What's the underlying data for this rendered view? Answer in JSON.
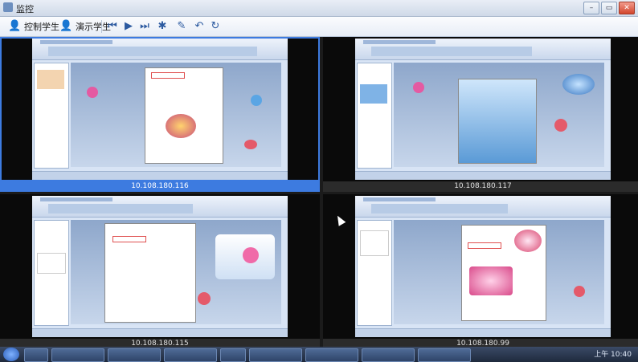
{
  "window": {
    "title": "监控",
    "icon": "monitor-icon",
    "controls": [
      "minimize-icon",
      "restore-icon",
      "close-icon"
    ]
  },
  "toolbar": {
    "control_student": "控制学生",
    "demo_student": "演示学生",
    "icons": [
      "first-icon",
      "play-icon",
      "next-icon",
      "settings-icon",
      "tool-icon",
      "undo-icon",
      "refresh-icon"
    ]
  },
  "screens": [
    {
      "ip": "10.108.180.116",
      "selected": true
    },
    {
      "ip": "10.108.180.117",
      "selected": false
    },
    {
      "ip": "10.108.180.115",
      "selected": false
    },
    {
      "ip": "10.108.180.99",
      "selected": false
    }
  ],
  "taskbar": {
    "clock": "上午 10:40"
  },
  "colors": {
    "accent": "#3d7be0",
    "screen_bg": "#0a0a0a"
  }
}
